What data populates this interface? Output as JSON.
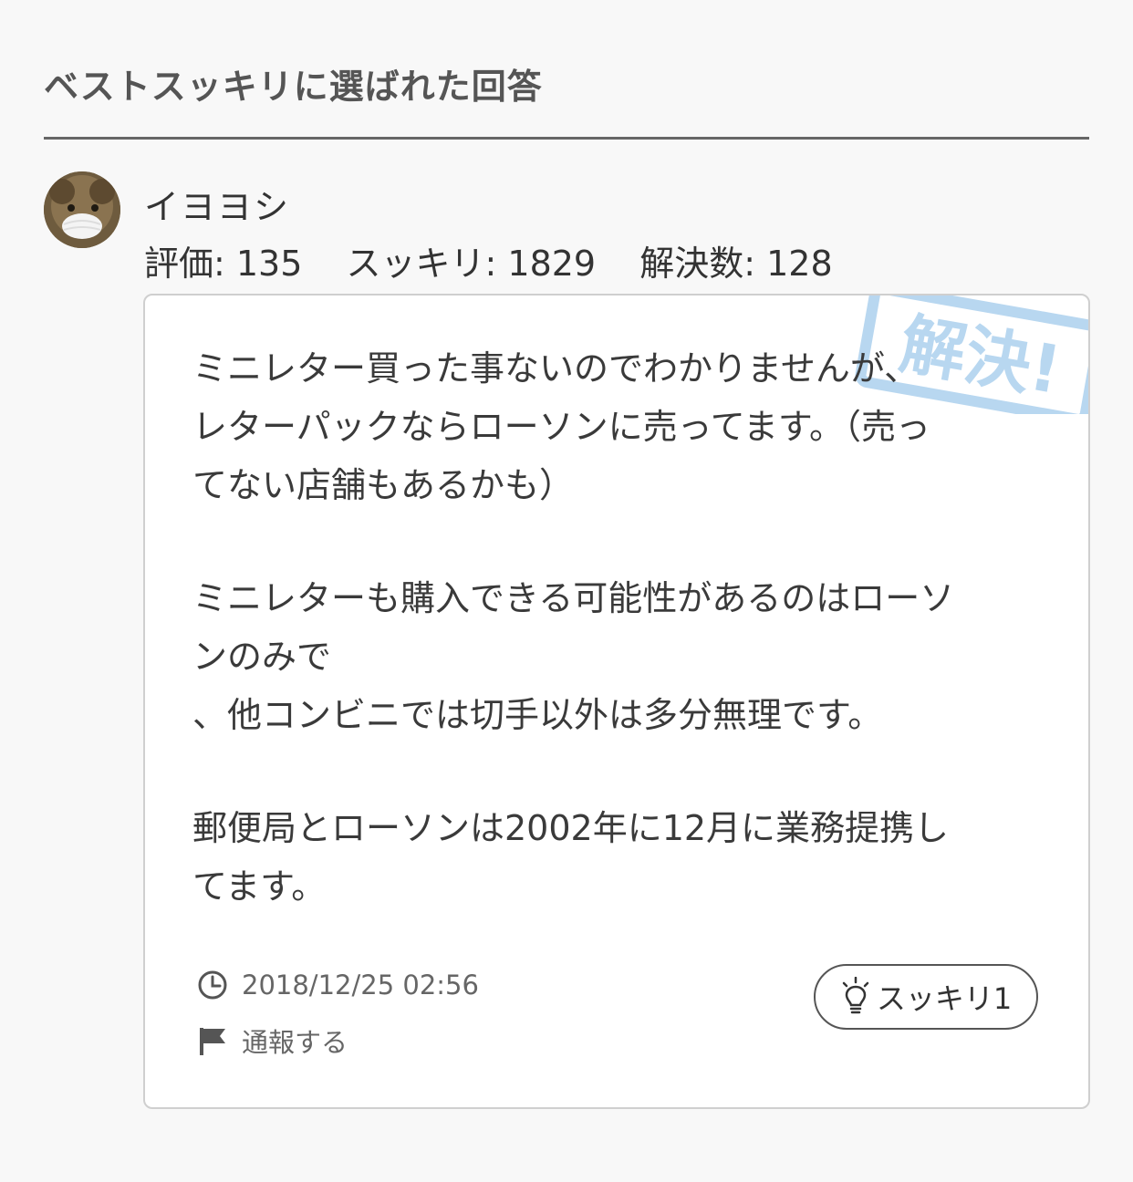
{
  "section": {
    "title": "ベストスッキリに選ばれた回答"
  },
  "user": {
    "name": "イヨヨシ",
    "rating": "評価: 135",
    "sukkiri": "スッキリ: 1829",
    "solved": "解決数: 128"
  },
  "answer": {
    "stamp": "解決!",
    "paragraphs": [
      [
        "ミニレター買った事ないのでわかりませんが、",
        "レターパックならローソンに売ってます。（売っ",
        "てない店舗もあるかも）"
      ],
      [
        "ミニレターも購入できる可能性があるのはローソ",
        "ンのみで",
        "、他コンビニでは切手以外は多分無理です。"
      ],
      [
        "郵便局とローソンは2002年に12月に業務提携し",
        "てます。"
      ]
    ],
    "timestamp": "2018/12/25 02:56",
    "report_label": "通報する",
    "sukkiri_button_label": "スッキリ1"
  },
  "icons": {
    "time": "clock-icon",
    "report": "flag-icon",
    "sukkiri": "lightbulb-icon"
  },
  "colors": {
    "background": "#f8f8f8",
    "stamp": "#b8d7f0"
  }
}
